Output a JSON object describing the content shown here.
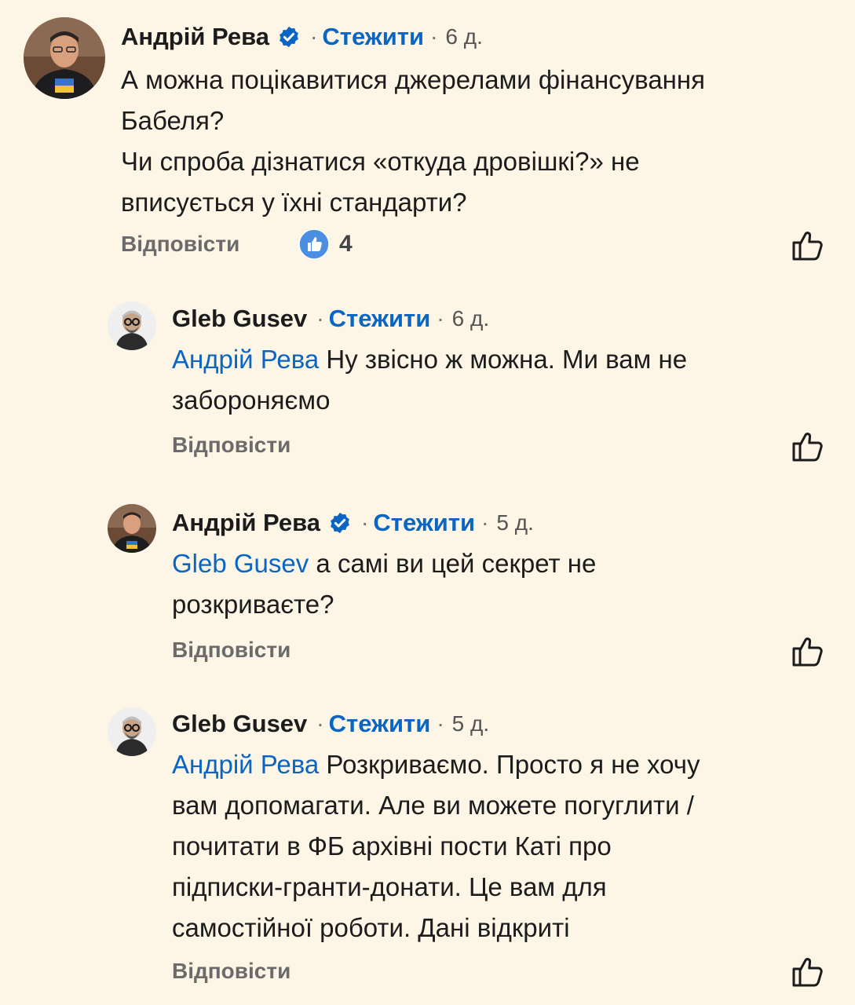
{
  "colors": {
    "background": "#fdf5e6",
    "link": "#0a66c2",
    "muted": "#6b6b6b"
  },
  "comments": [
    {
      "author": "Андрій Рева",
      "verified": true,
      "follow_label": "Стежити",
      "separator": "·",
      "time": "6 д.",
      "text_lines": [
        "А можна поцікавитися джерелами фінансування",
        "Бабеля?",
        "Чи спроба дізнатися «откуда дровішкі?» не",
        "вписується у їхні стандарти?"
      ],
      "reply_label": "Відповісти",
      "reaction_icon": "like-reaction-icon",
      "reaction_count": "4",
      "like_icon": "thumbs-up-outline-icon"
    },
    {
      "author": "Gleb Gusev",
      "verified": false,
      "follow_label": "Стежити",
      "separator": "·",
      "time": "6 д.",
      "mention": "Андрій Рева",
      "text_lines": [
        " Ну звісно ж можна. Ми вам не",
        "забороняємо"
      ],
      "reply_label": "Відповісти",
      "like_icon": "thumbs-up-outline-icon"
    },
    {
      "author": "Андрій Рева",
      "verified": true,
      "follow_label": "Стежити",
      "separator": "·",
      "time": "5 д.",
      "mention": "Gleb Gusev",
      "text_lines": [
        " а самі ви цей секрет не",
        "розкриваєте?"
      ],
      "reply_label": "Відповісти",
      "like_icon": "thumbs-up-outline-icon"
    },
    {
      "author": "Gleb Gusev",
      "verified": false,
      "follow_label": "Стежити",
      "separator": "·",
      "time": "5 д.",
      "mention": "Андрій Рева",
      "text_lines": [
        " Розкриваємо. Просто я не хочу",
        "вам допомагати. Але ви можете погуглити /",
        "почитати в ФБ архівні пости Каті про",
        "підписки-гранти-донати. Це вам для",
        "самостійної роботи. Дані відкриті"
      ],
      "reply_label": "Відповісти",
      "like_icon": "thumbs-up-outline-icon"
    }
  ]
}
